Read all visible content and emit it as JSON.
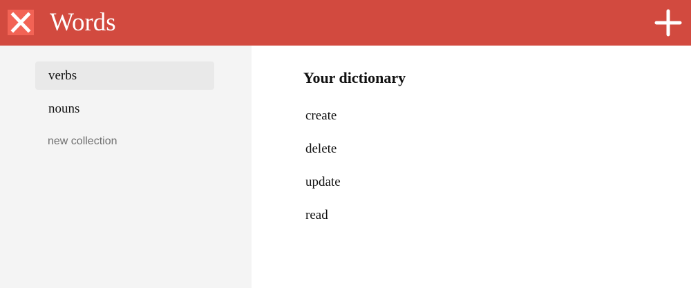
{
  "header": {
    "title": "Words",
    "close_icon": "close-icon",
    "add_icon": "plus-icon",
    "accent_color": "#d24a3f"
  },
  "sidebar": {
    "collections": [
      {
        "label": "verbs",
        "selected": true
      },
      {
        "label": "nouns",
        "selected": false
      }
    ],
    "new_collection_label": "new collection"
  },
  "main": {
    "title": "Your dictionary",
    "words": [
      "create",
      "delete",
      "update",
      "read"
    ]
  }
}
